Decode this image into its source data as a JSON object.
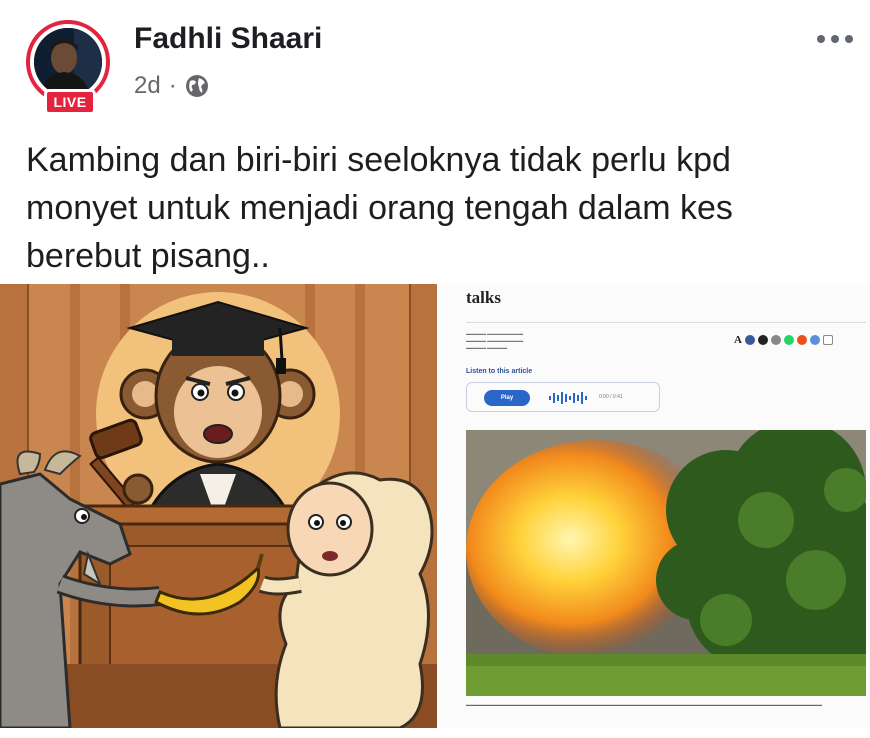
{
  "post": {
    "author": "Fadhli Shaari",
    "live_badge": "LIVE",
    "time": "2d",
    "separator": "·",
    "privacy_icon": "globe-icon",
    "more_icon": "more-horizontal-icon",
    "text": "Kambing dan biri-biri seeloknya tidak perlu kpd monyet untuk menjadi orang tengah dalam kes berebut pisang.."
  },
  "article": {
    "title": "talks",
    "listen_label": "Listen to this article",
    "play_label": "Play",
    "time": "0:00 / 0:41"
  },
  "colors": {
    "live_red": "#e4233e",
    "meta_gray": "#65676b",
    "player_blue": "#2a66c8"
  }
}
